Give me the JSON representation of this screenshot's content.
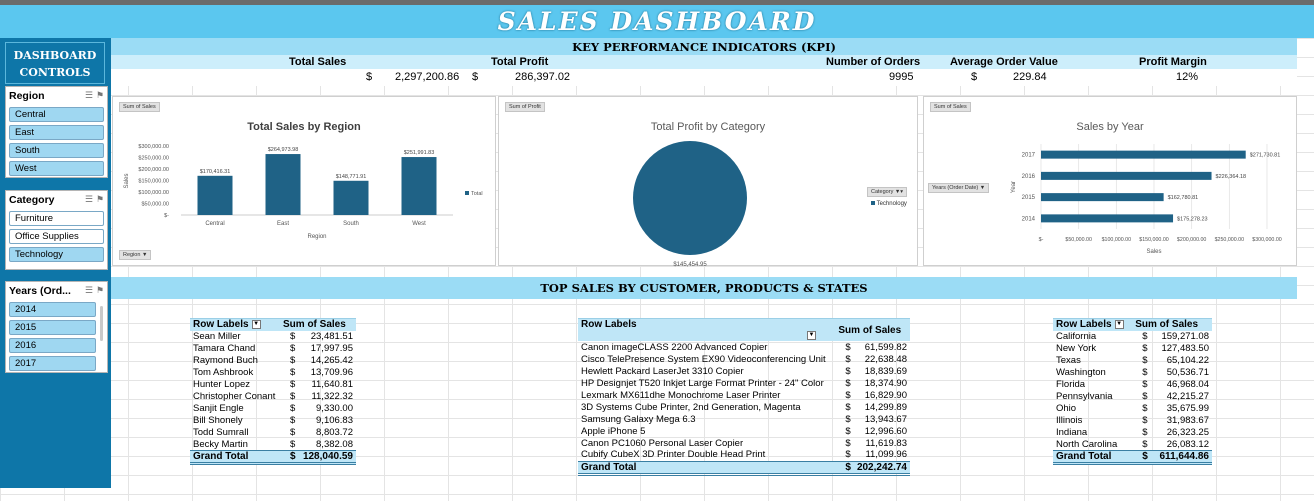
{
  "banner": {
    "title": "SALES DASHBOARD"
  },
  "sidebar": {
    "title_line1": "DASHBOARD",
    "title_line2": "CONTROLS"
  },
  "slicers": {
    "region": {
      "title": "Region",
      "items": [
        {
          "label": "Central",
          "selected": true
        },
        {
          "label": "East",
          "selected": true
        },
        {
          "label": "South",
          "selected": true
        },
        {
          "label": "West",
          "selected": true
        }
      ]
    },
    "category": {
      "title": "Category",
      "items": [
        {
          "label": "Furniture",
          "selected": false
        },
        {
          "label": "Office Supplies",
          "selected": false
        },
        {
          "label": "Technology",
          "selected": true
        }
      ]
    },
    "years": {
      "title": "Years (Ord...",
      "items": [
        {
          "label": "2014",
          "selected": true
        },
        {
          "label": "2015",
          "selected": true
        },
        {
          "label": "2016",
          "selected": true
        },
        {
          "label": "2017",
          "selected": true
        }
      ]
    }
  },
  "kpi": {
    "title": "KEY PERFORMANCE INDICATORS (KPI)",
    "headers": {
      "total_sales": "Total Sales",
      "total_profit": "Total Profit",
      "orders": "Number of Orders",
      "aov": "Average Order Value",
      "margin": "Profit Margin"
    },
    "values": {
      "sales_currency": "$",
      "total_sales": "2,297,200.86",
      "profit_currency": "$",
      "total_profit": "286,397.02",
      "orders": "9995",
      "aov_currency": "$",
      "aov": "229.84",
      "margin": "12%"
    }
  },
  "chart_data": [
    {
      "type": "bar",
      "button": "Sum of Sales",
      "title": "Total Sales by Region",
      "xlabel": "Region",
      "ylabel": "Sales",
      "categories": [
        "Central",
        "East",
        "South",
        "West"
      ],
      "values": [
        170416.31,
        264973.98,
        148771.91,
        251991.83
      ],
      "value_labels": [
        "$170,416.31",
        "$264,973.98",
        "$148,771.91",
        "$251,991.83"
      ],
      "yticks": [
        "$300,000.00",
        "$250,000.00",
        "$200,000.00",
        "$150,000.00",
        "$100,000.00",
        "$50,000.00",
        "$-"
      ],
      "ylim": [
        0,
        300000
      ],
      "legend": "Total",
      "filter_button": "Region",
      "color": "#1f6286"
    },
    {
      "type": "pie",
      "button": "Sum of Profit",
      "title": "Total Profit by Category",
      "categories": [
        "Technology"
      ],
      "values": [
        145454.95
      ],
      "value_labels": [
        "$145,454.95"
      ],
      "legend": "Technology",
      "filter_button": "Category",
      "color": "#1f6286"
    },
    {
      "type": "bar",
      "orientation": "horizontal",
      "button": "Sum of Sales",
      "title": "Sales by Year",
      "xlabel": "Sales",
      "ylabel": "Year",
      "categories": [
        "2017",
        "2016",
        "2015",
        "2014"
      ],
      "values": [
        271730.81,
        226364.18,
        162780.81,
        175278.23
      ],
      "value_labels": [
        "$271,730.81",
        "$226,364.18",
        "$162,780.81",
        "$175,278.23"
      ],
      "xticks": [
        "$-",
        "$50,000.00",
        "$100,000.00",
        "$150,000.00",
        "$200,000.00",
        "$250,000.00",
        "$300,000.00"
      ],
      "xlim": [
        0,
        300000
      ],
      "filter_button": "Years (Order Date)",
      "color": "#1f6286"
    }
  ],
  "top_sales": {
    "title": "TOP SALES BY CUSTOMER, PRODUCTS & STATES",
    "customers": {
      "col1": "Row Labels",
      "col2": "Sum of Sales",
      "rows": [
        [
          "Sean Miller",
          "$",
          "23,481.51"
        ],
        [
          "Tamara Chand",
          "$",
          "17,997.95"
        ],
        [
          "Raymond Buch",
          "$",
          "14,265.42"
        ],
        [
          "Tom Ashbrook",
          "$",
          "13,709.96"
        ],
        [
          "Hunter Lopez",
          "$",
          "11,640.81"
        ],
        [
          "Christopher Conant",
          "$",
          "11,322.32"
        ],
        [
          "Sanjit Engle",
          "$",
          "9,330.00"
        ],
        [
          "Bill Shonely",
          "$",
          "9,106.83"
        ],
        [
          "Todd Sumrall",
          "$",
          "8,803.72"
        ],
        [
          "Becky Martin",
          "$",
          "8,382.08"
        ]
      ],
      "total_label": "Grand Total",
      "total_currency": "$",
      "total": "128,040.59"
    },
    "products": {
      "col1": "Row Labels",
      "col2": "Sum of Sales",
      "rows": [
        [
          "Canon imageCLASS 2200 Advanced Copier",
          "$",
          "61,599.82"
        ],
        [
          "Cisco TelePresence System EX90 Videoconferencing Unit",
          "$",
          "22,638.48"
        ],
        [
          "Hewlett Packard LaserJet 3310 Copier",
          "$",
          "18,839.69"
        ],
        [
          "HP Designjet T520 Inkjet Large Format Printer - 24\" Color",
          "$",
          "18,374.90"
        ],
        [
          "Lexmark MX611dhe Monochrome Laser Printer",
          "$",
          "16,829.90"
        ],
        [
          "3D Systems Cube Printer, 2nd Generation, Magenta",
          "$",
          "14,299.89"
        ],
        [
          "Samsung Galaxy Mega 6.3",
          "$",
          "13,943.67"
        ],
        [
          "Apple iPhone 5",
          "$",
          "12,996.60"
        ],
        [
          "Canon PC1060 Personal Laser Copier",
          "$",
          "11,619.83"
        ],
        [
          "Cubify CubeX 3D Printer Double Head Print",
          "$",
          "11,099.96"
        ]
      ],
      "total_label": "Grand Total",
      "total_currency": "$",
      "total": "202,242.74"
    },
    "states": {
      "col1": "Row Labels",
      "col2": "Sum of Sales",
      "rows": [
        [
          "California",
          "$",
          "159,271.08"
        ],
        [
          "New York",
          "$",
          "127,483.50"
        ],
        [
          "Texas",
          "$",
          "65,104.22"
        ],
        [
          "Washington",
          "$",
          "50,536.71"
        ],
        [
          "Florida",
          "$",
          "46,968.04"
        ],
        [
          "Pennsylvania",
          "$",
          "42,215.27"
        ],
        [
          "Ohio",
          "$",
          "35,675.99"
        ],
        [
          "Illinois",
          "$",
          "31,983.67"
        ],
        [
          "Indiana",
          "$",
          "26,323.25"
        ],
        [
          "North Carolina",
          "$",
          "26,083.12"
        ]
      ],
      "total_label": "Grand Total",
      "total_currency": "$",
      "total": "611,644.86"
    }
  }
}
